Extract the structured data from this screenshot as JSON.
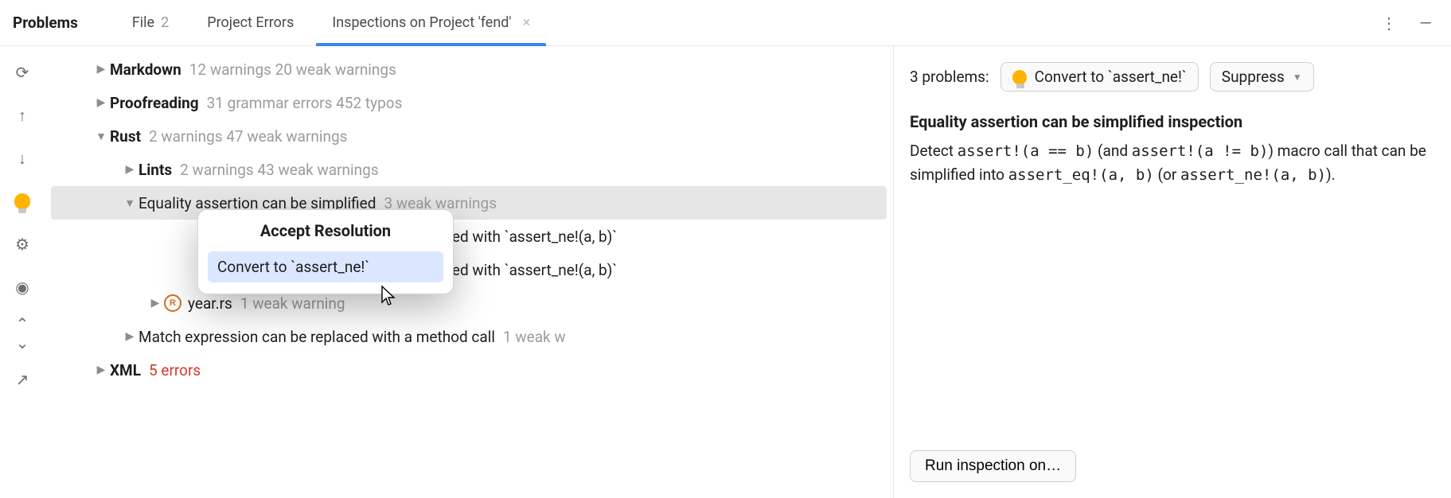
{
  "topbar": {
    "title": "Problems",
    "tabs": [
      {
        "label": "File",
        "count": "2",
        "closable": false,
        "active": false
      },
      {
        "label": "Project Errors",
        "count": "",
        "closable": false,
        "active": false
      },
      {
        "label": "Inspections on Project 'fend'",
        "count": "",
        "closable": true,
        "active": true
      }
    ],
    "more_icon_name": "more-vert-icon",
    "minimize_icon_name": "minimize-icon"
  },
  "rail": [
    {
      "name": "refresh-icon",
      "glyph": "⟳"
    },
    {
      "name": "arrow-up-icon",
      "glyph": "↑"
    },
    {
      "name": "arrow-down-icon",
      "glyph": "↓"
    },
    {
      "name": "bulb-icon",
      "glyph": ""
    },
    {
      "name": "gear-icon",
      "glyph": "⚙"
    },
    {
      "name": "eye-icon",
      "glyph": "◉"
    },
    {
      "name": "expand-all-icon",
      "glyph": "⌃"
    },
    {
      "name": "collapse-all-icon",
      "glyph": "⌄"
    },
    {
      "name": "export-icon",
      "glyph": "↗"
    }
  ],
  "tree": {
    "nodes": [
      {
        "depth": 0,
        "expanded": false,
        "label": "Markdown",
        "bold": true,
        "meta": "12 warnings 20 weak warnings",
        "selected": false,
        "icon": ""
      },
      {
        "depth": 0,
        "expanded": false,
        "label": "Proofreading",
        "bold": true,
        "meta": "31 grammar errors 452 typos",
        "selected": false,
        "icon": ""
      },
      {
        "depth": 0,
        "expanded": true,
        "label": "Rust",
        "bold": true,
        "meta": "2 warnings 47 weak warnings",
        "selected": false,
        "icon": ""
      },
      {
        "depth": 1,
        "expanded": false,
        "label": "Lints",
        "bold": true,
        "meta": "2 warnings 43 weak warnings",
        "selected": false,
        "icon": ""
      },
      {
        "depth": 1,
        "expanded": true,
        "label": "Equality assertion can be simplified",
        "bold": false,
        "meta": "3 weak warnings",
        "selected": true,
        "icon": ""
      },
      {
        "depth": 2,
        "expanded": false,
        "label": "replaced with `assert_ne!(a, b)`",
        "bold": false,
        "meta": "",
        "selected": false,
        "icon": "",
        "partial": true
      },
      {
        "depth": 2,
        "expanded": false,
        "label": "replaced with `assert_ne!(a, b)`",
        "bold": false,
        "meta": "",
        "selected": false,
        "icon": "",
        "partial": true
      },
      {
        "depth": 2,
        "expanded": false,
        "label": "year.rs",
        "bold": false,
        "meta": "1 weak warning",
        "selected": false,
        "icon": "rust"
      },
      {
        "depth": 1,
        "expanded": false,
        "label": "Match expression can be replaced with a method call",
        "bold": false,
        "meta": "1 weak w",
        "selected": false,
        "icon": "",
        "trunc": true
      },
      {
        "depth": 0,
        "expanded": false,
        "label": "XML",
        "bold": true,
        "meta": "5 errors",
        "metaClass": "error",
        "selected": false,
        "icon": ""
      }
    ]
  },
  "popup": {
    "title": "Accept Resolution",
    "item": "Convert to `assert_ne!`"
  },
  "details": {
    "problems_label": "3 problems:",
    "fix_button": "Convert to `assert_ne!`",
    "suppress_button": "Suppress",
    "inspection_title": "Equality assertion can be simplified inspection",
    "body_parts": {
      "t1": "Detect ",
      "c1": "assert!(a == b)",
      "t2": " (and ",
      "c2": "assert!(a != b)",
      "t3": ") macro call that can be simplified into ",
      "c3": "assert_eq!(a, b)",
      "t4": " (or ",
      "c4": "assert_ne!(a, b)",
      "t5": ")."
    },
    "run_button": "Run inspection on…"
  }
}
